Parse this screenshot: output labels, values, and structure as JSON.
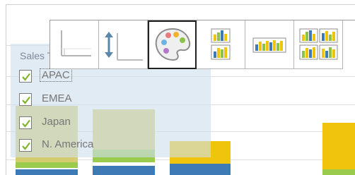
{
  "legend": {
    "title": "Sales Territory",
    "items": [
      {
        "label": "APAC",
        "checked": true,
        "focused": true
      },
      {
        "label": "EMEA",
        "checked": true,
        "focused": false
      },
      {
        "label": "Japan",
        "checked": true,
        "focused": false
      },
      {
        "label": "N. America",
        "checked": true,
        "focused": false
      }
    ]
  },
  "toolbar": {
    "buttons": [
      {
        "icon": "axis-icon",
        "selected": false
      },
      {
        "icon": "sort-vertical-icon",
        "selected": false
      },
      {
        "icon": "palette-icon",
        "selected": true
      },
      {
        "icon": "stacked-bar-small-multiples-icon",
        "selected": false
      },
      {
        "icon": "bar-chart-wide-icon",
        "selected": false
      },
      {
        "icon": "bar-chart-grid-icon",
        "selected": false
      }
    ]
  },
  "colors": {
    "apac": "#d4cc6e",
    "emea": "#9acb4c",
    "japan": "#f0c40d",
    "n_america": "#3e7ab6",
    "legend_overlay": "#cfdeec",
    "check": "#7fb52b"
  }
}
